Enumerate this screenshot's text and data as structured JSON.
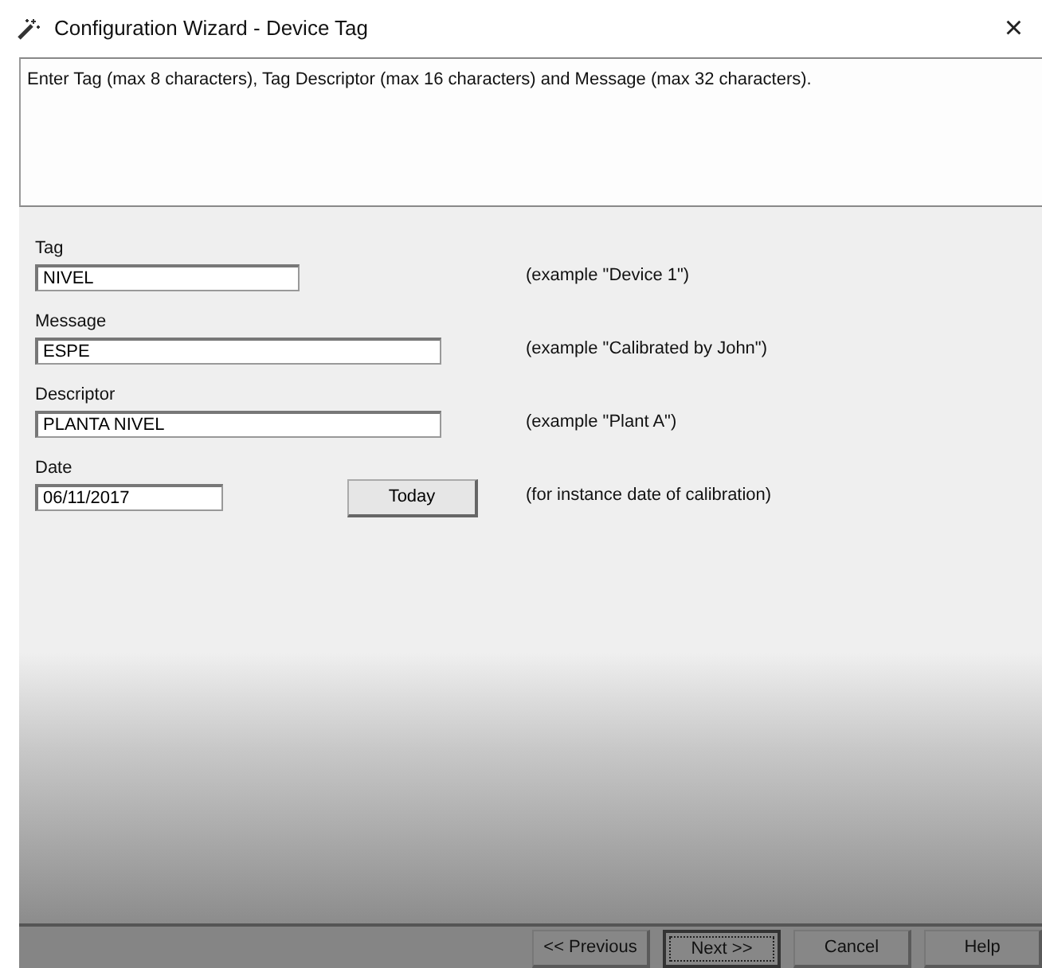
{
  "window": {
    "title": "Configuration Wizard - Device Tag",
    "close": "×"
  },
  "instructions": "Enter Tag (max 8 characters), Tag Descriptor (max 16 characters) and Message (max 32 characters).",
  "fields": [
    {
      "label": "Tag",
      "value": "NIVEL",
      "hint": "(example \"Device 1\")",
      "kind": "short"
    },
    {
      "label": "Message",
      "value": "ESPE",
      "hint": "(example \"Calibrated by John\")",
      "kind": "long"
    },
    {
      "label": "Descriptor",
      "value": "PLANTA NIVEL",
      "hint": "(example \"Plant A\")",
      "kind": "long"
    },
    {
      "label": "Date",
      "value": "06/11/2017",
      "hint": "(for instance date of calibration)",
      "kind": "date",
      "button": {
        "label": "Today"
      }
    }
  ],
  "buttons": [
    {
      "label": "<< Previous",
      "default": false
    },
    {
      "label": "Next >>",
      "default": true
    },
    {
      "label": "Cancel",
      "default": false
    },
    {
      "label": "Help",
      "default": false
    }
  ]
}
